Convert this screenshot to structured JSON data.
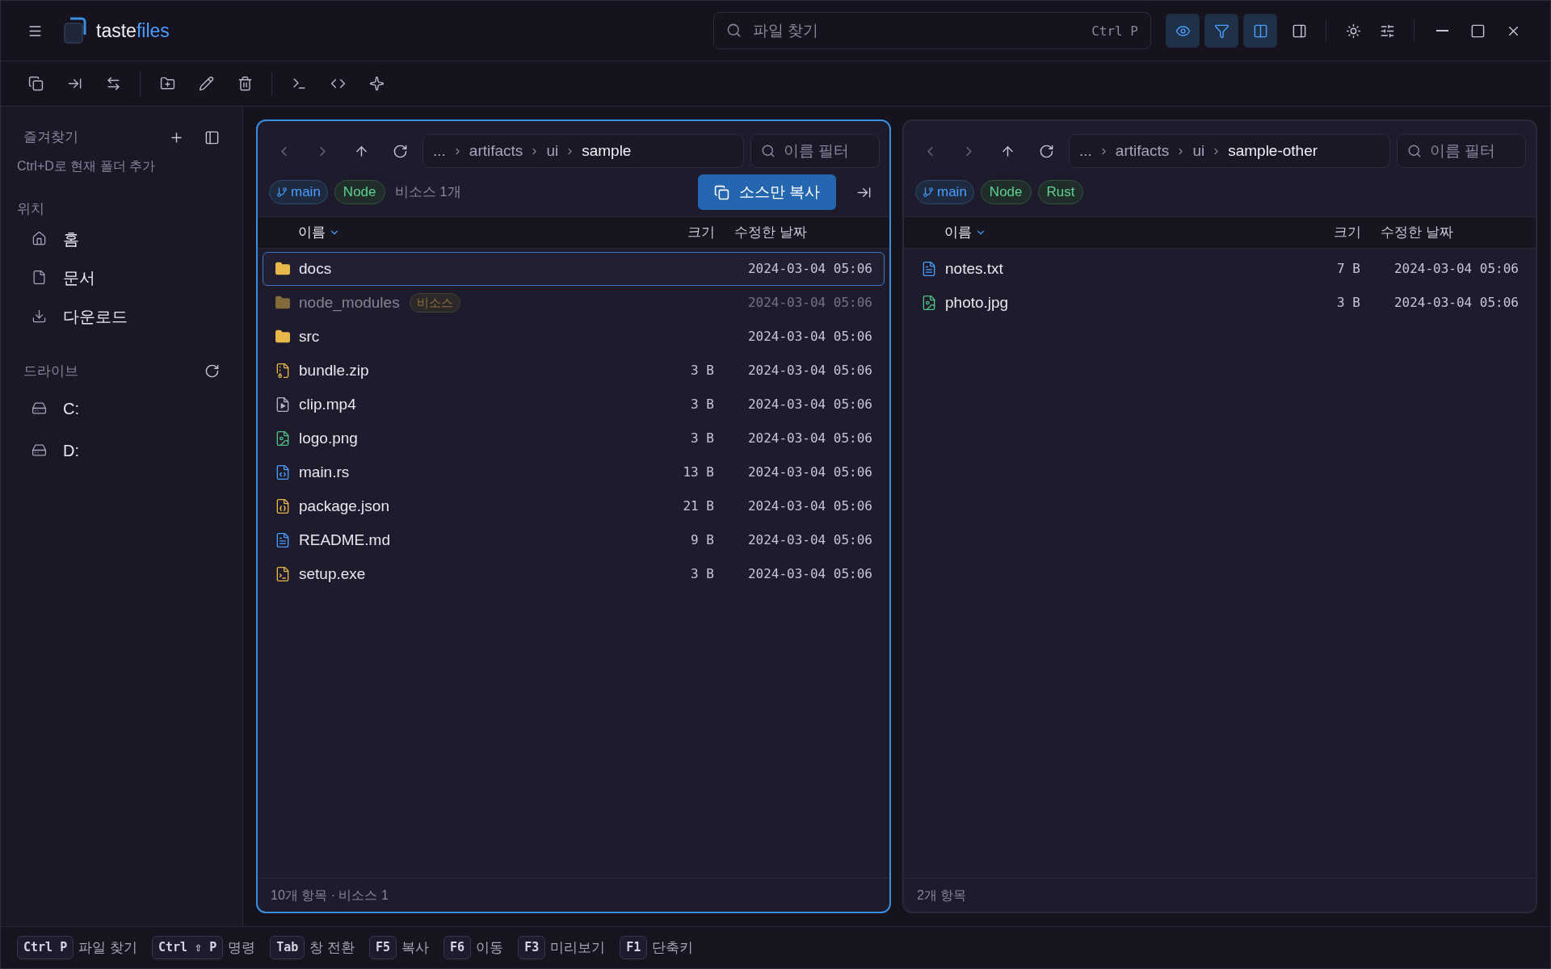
{
  "app": {
    "logo_part1": "taste",
    "logo_part2": "files"
  },
  "search": {
    "placeholder": "파일 찾기",
    "shortcut": "Ctrl P"
  },
  "view_toggles": [
    {
      "kind": "eye",
      "on": true
    },
    {
      "kind": "filter",
      "on": true
    },
    {
      "kind": "columns",
      "on": true
    },
    {
      "kind": "panel",
      "on": false
    }
  ],
  "sidebar": {
    "favorites_title": "즐겨찾기",
    "favorites_hint": "Ctrl+D로 현재 폴더 추가",
    "locations_title": "위치",
    "locations": [
      {
        "kind": "home",
        "label": "홈"
      },
      {
        "kind": "document",
        "label": "문서"
      },
      {
        "kind": "download",
        "label": "다운로드"
      }
    ],
    "drives_title": "드라이브",
    "drives": [
      {
        "label": "C:"
      },
      {
        "label": "D:"
      }
    ]
  },
  "panes": [
    {
      "selected": true,
      "breadcrumb": [
        "...",
        "artifacts",
        "ui",
        "sample"
      ],
      "filter_placeholder": "이름 필터",
      "tags": [
        {
          "kind": "branch",
          "label": "main"
        },
        {
          "kind": "tech",
          "label": "Node"
        }
      ],
      "note": "비소스 1개",
      "action": "소스만 복사",
      "columns": [
        "이름",
        "크기",
        "수정한 날짜"
      ],
      "rows": [
        {
          "kind": "folder",
          "name": "docs",
          "date": "2024-03-04 05:06",
          "selected": true,
          "dimmed": false
        },
        {
          "kind": "folder",
          "name": "node_modules",
          "badge": "비소스",
          "date": "2024-03-04 05:06",
          "selected": false,
          "dimmed": true
        },
        {
          "kind": "folder",
          "name": "src",
          "date": "2024-03-04 05:06",
          "selected": false,
          "dimmed": false
        },
        {
          "kind": "archive",
          "name": "bundle.zip",
          "size": "3 B",
          "date": "2024-03-04 05:06",
          "selected": false,
          "dimmed": false
        },
        {
          "kind": "video",
          "name": "clip.mp4",
          "size": "3 B",
          "date": "2024-03-04 05:06",
          "selected": false,
          "dimmed": false
        },
        {
          "kind": "image",
          "name": "logo.png",
          "size": "3 B",
          "date": "2024-03-04 05:06",
          "selected": false,
          "dimmed": false
        },
        {
          "kind": "code",
          "name": "main.rs",
          "size": "13 B",
          "date": "2024-03-04 05:06",
          "selected": false,
          "dimmed": false
        },
        {
          "kind": "config",
          "name": "package.json",
          "size": "21 B",
          "date": "2024-03-04 05:06",
          "selected": false,
          "dimmed": false
        },
        {
          "kind": "text",
          "name": "README.md",
          "size": "9 B",
          "date": "2024-03-04 05:06",
          "selected": false,
          "dimmed": false
        },
        {
          "kind": "executable",
          "name": "setup.exe",
          "size": "3 B",
          "date": "2024-03-04 05:06",
          "selected": false,
          "dimmed": false
        }
      ],
      "footer": "10개 항목 · 비소스 1"
    },
    {
      "selected": false,
      "breadcrumb": [
        "...",
        "artifacts",
        "ui",
        "sample-other"
      ],
      "filter_placeholder": "이름 필터",
      "tags": [
        {
          "kind": "branch",
          "label": "main"
        },
        {
          "kind": "tech",
          "label": "Node"
        },
        {
          "kind": "tech",
          "label": "Rust"
        }
      ],
      "columns": [
        "이름",
        "크기",
        "수정한 날짜"
      ],
      "rows": [
        {
          "kind": "text",
          "name": "notes.txt",
          "size": "7 B",
          "date": "2024-03-04 05:06",
          "selected": false,
          "dimmed": false
        },
        {
          "kind": "image",
          "name": "photo.jpg",
          "size": "3 B",
          "date": "2024-03-04 05:06",
          "selected": false,
          "dimmed": false
        }
      ],
      "footer": "2개 항목"
    }
  ],
  "status_bar": [
    {
      "keys": "Ctrl P",
      "label": "파일 찾기"
    },
    {
      "keys": "Ctrl ⇧ P",
      "label": "명령"
    },
    {
      "keys": "Tab",
      "label": "창 전환"
    },
    {
      "keys": "F5",
      "label": "복사"
    },
    {
      "keys": "F6",
      "label": "이동"
    },
    {
      "keys": "F3",
      "label": "미리보기"
    },
    {
      "keys": "F1",
      "label": "단축키"
    }
  ]
}
